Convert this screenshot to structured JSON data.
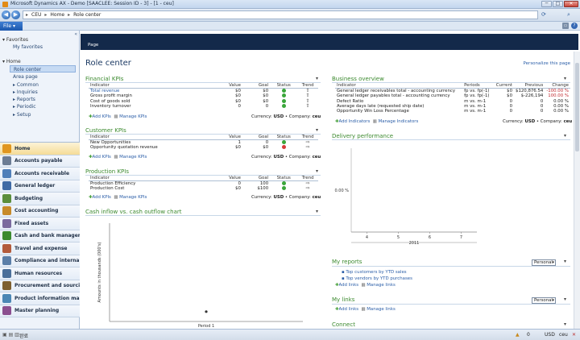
{
  "window": {
    "title": "Microsoft Dynamics AX - Demo [SAACLEE: Session ID - 3] - [1 - ceu]",
    "buttons": [
      "─",
      "□",
      "✕"
    ]
  },
  "address": {
    "segments": [
      "CEU",
      "Home",
      "Role center"
    ]
  },
  "command": {
    "file_label": "File"
  },
  "nav": {
    "favorites_label": "Favorites",
    "my_favorites": "My favorites",
    "home_label": "Home",
    "home_items": [
      "Role center",
      "Area page",
      "Common",
      "Inquiries",
      "Reports",
      "Periodic",
      "Setup"
    ],
    "modules": [
      {
        "label": "Home",
        "color": "#e0961f"
      },
      {
        "label": "Accounts payable",
        "color": "#6b7c94"
      },
      {
        "label": "Accounts receivable",
        "color": "#4f7fb9"
      },
      {
        "label": "General ledger",
        "color": "#3f6aa5"
      },
      {
        "label": "Budgeting",
        "color": "#5b8e3c"
      },
      {
        "label": "Cost accounting",
        "color": "#c78a2a"
      },
      {
        "label": "Fixed assets",
        "color": "#7a6a9e"
      },
      {
        "label": "Cash and bank managem...",
        "color": "#3c8a2f"
      },
      {
        "label": "Travel and expense",
        "color": "#b35b3c"
      },
      {
        "label": "Compliance and internal ...",
        "color": "#5a7ea8"
      },
      {
        "label": "Human resources",
        "color": "#4a6f9a"
      },
      {
        "label": "Procurement and sourcing",
        "color": "#7d5f2f"
      },
      {
        "label": "Product information manag...",
        "color": "#4b87b5"
      },
      {
        "label": "Master planning",
        "color": "#8b4f8f"
      }
    ]
  },
  "page": {
    "tab": "Page",
    "title": "Role center",
    "personalize": "Personalize this page"
  },
  "financial": {
    "title": "Financial KPIs",
    "headers": [
      "Indicator",
      "Value",
      "Goal",
      "Status",
      "Trend"
    ],
    "rows": [
      {
        "indicator": "Total revenue",
        "value": "$0",
        "goal": "$0",
        "status": "#3aa63a",
        "trend": "⇧"
      },
      {
        "indicator": "Gross profit margin",
        "value": "$0",
        "goal": "$0",
        "status": "#3aa63a",
        "trend": "⇧"
      },
      {
        "indicator": "Cost of goods sold",
        "value": "$0",
        "goal": "$0",
        "status": "#3aa63a",
        "trend": "⇧"
      },
      {
        "indicator": "Inventory turnover",
        "value": "0",
        "goal": "0",
        "status": "#3aa63a",
        "trend": "⇧"
      }
    ],
    "add": "Add KPIs",
    "manage": "Manage KPIs",
    "currency_label": "Currency:",
    "currency": "USD",
    "company_label": "Company:",
    "company": "ceu"
  },
  "customer": {
    "title": "Customer KPIs",
    "headers": [
      "Indicator",
      "Value",
      "Goal",
      "Status",
      "Trend"
    ],
    "rows": [
      {
        "indicator": "New Opportunities",
        "value": "1",
        "goal": "0",
        "status": "#3aa63a",
        "trend": "⇨"
      },
      {
        "indicator": "Opportunity quotation revenue",
        "value": "$0",
        "goal": "$0",
        "status": "#d63a3a",
        "trend": "⇨"
      }
    ],
    "add": "Add KPIs",
    "manage": "Manage KPIs",
    "currency_label": "Currency:",
    "currency": "USD",
    "company_label": "Company:",
    "company": "ceu"
  },
  "production": {
    "title": "Production KPIs",
    "headers": [
      "Indicator",
      "Value",
      "Goal",
      "Status",
      "Trend"
    ],
    "rows": [
      {
        "indicator": "Production Efficiency",
        "value": "0",
        "goal": "100",
        "status": "#3aa63a",
        "trend": "⇨"
      },
      {
        "indicator": "Production Cost",
        "value": "$0",
        "goal": "$100",
        "status": "#3aa63a",
        "trend": "⇨"
      }
    ],
    "add": "Add KPIs",
    "manage": "Manage KPIs",
    "currency_label": "Currency:",
    "currency": "USD",
    "company_label": "Company:",
    "company": "ceu"
  },
  "cashflow": {
    "title": "Cash inflow vs. cash outflow chart",
    "ylabel": "Amounts in thousands (000's)",
    "xlabel": "Period 1"
  },
  "business": {
    "title": "Business overview",
    "headers": [
      "Indicator",
      "Periods",
      "Current",
      "Previous",
      "Change"
    ],
    "rows": [
      {
        "indicator": "General ledger receivables total - accounting currency",
        "periods": "fp vs. fp(-1)",
        "current": "$0",
        "previous": "$120,876.54",
        "change": "-100.00 %"
      },
      {
        "indicator": "General ledger payables total - accounting currency",
        "periods": "fp vs. fp(-1)",
        "current": "$0",
        "previous": "$-226,194",
        "change": "100.00 %"
      },
      {
        "indicator": "Defect Ratio",
        "periods": "m vs. m-1",
        "current": "0",
        "previous": "0",
        "change": "0.00 %"
      },
      {
        "indicator": "Average days late (requested ship date)",
        "periods": "m vs. m-1",
        "current": "0",
        "previous": "0",
        "change": "0.00 %"
      },
      {
        "indicator": "Opportunity Win Loss Percentage",
        "periods": "m vs. m-1",
        "current": "0",
        "previous": "0",
        "change": "0.00 %"
      }
    ],
    "add": "Add Indicators",
    "manage": "Manage Indicators",
    "currency_label": "Currency:",
    "currency": "USD",
    "company_label": "Company:",
    "company": "ceu"
  },
  "delivery": {
    "title": "Delivery performance"
  },
  "chart_data": [
    {
      "type": "scatter",
      "title": "Cash inflow vs. cash outflow chart",
      "ylabel": "Amounts in thousands (000's)",
      "categories": [
        "Period 1"
      ],
      "values": [
        0
      ]
    },
    {
      "type": "bar",
      "title": "Delivery performance",
      "categories": [
        "4",
        "5",
        "6",
        "7"
      ],
      "values": [
        0,
        0,
        0,
        0
      ],
      "y_tick_label": "0.00 %",
      "x_group_label": "2011"
    }
  ],
  "myreports": {
    "title": "My reports",
    "dropdown": "Personal",
    "links": [
      "Top customers by YTD sales",
      "Top vendors by YTD purchases"
    ],
    "add": "Add links",
    "manage": "Manage links"
  },
  "mylinks": {
    "title": "My links",
    "dropdown": "Personal",
    "add": "Add links",
    "manage": "Manage links"
  },
  "connect": {
    "title": "Connect"
  },
  "status": {
    "left": "완료",
    "currency": "USD",
    "company": "ceu",
    "mode": "✕"
  }
}
